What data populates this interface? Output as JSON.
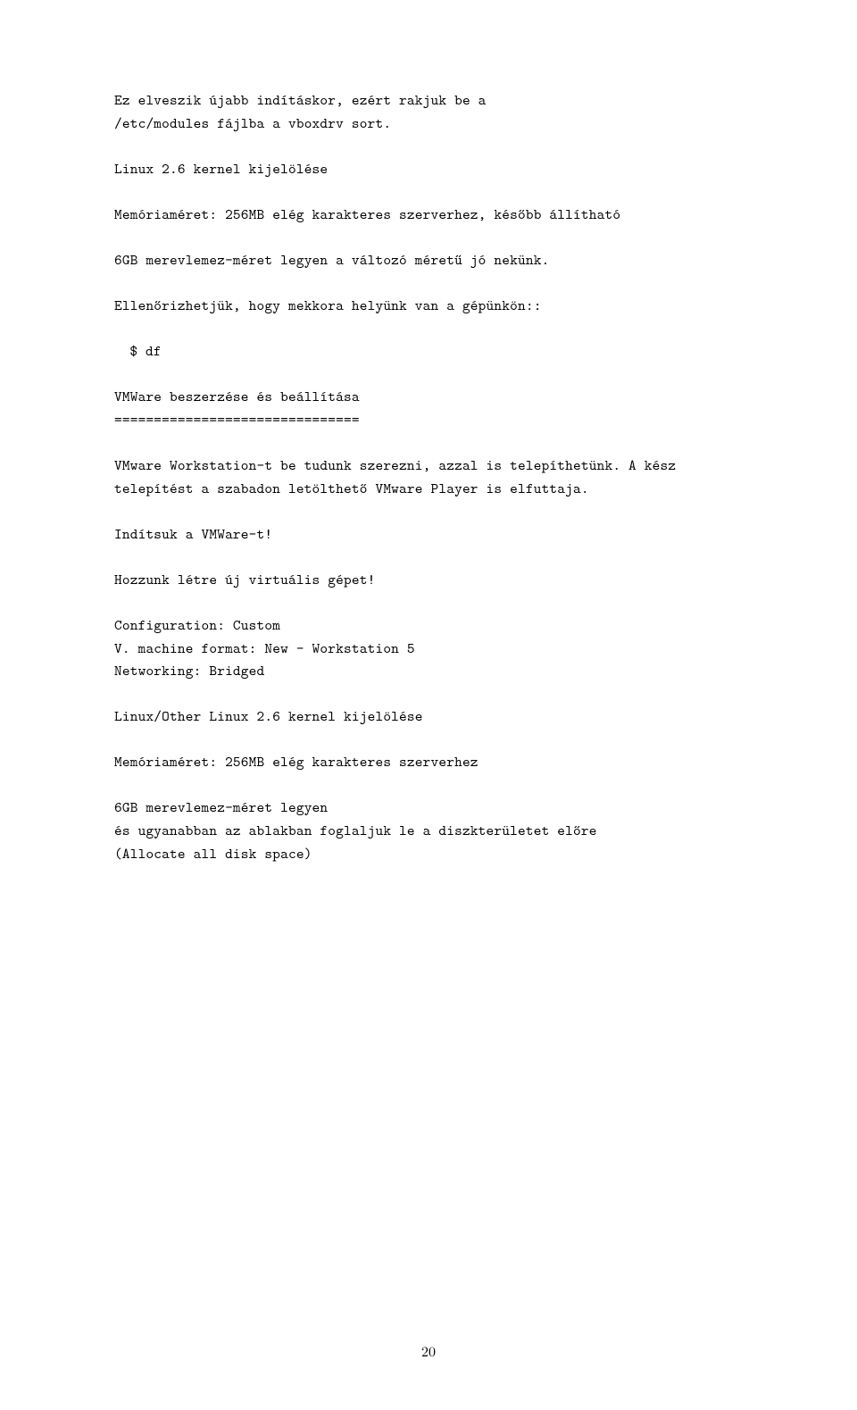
{
  "p1": "Ez elveszik újabb indításkor, ezért rakjuk be a",
  "p2": "/etc/modules fájlba a vboxdrv sort.",
  "p3": "Linux 2.6 kernel kijelölése",
  "p4": "Memóriaméret: 256MB elég karakteres szerverhez, később állítható",
  "p5": "6GB merevlemez-méret legyen a változó méretű jó nekünk.",
  "p6": "Ellenőrizhetjük, hogy mekkora helyünk van a gépünkön::",
  "p7": "$ df",
  "p8": "VMWare beszerzése és beállítása",
  "p9": "===============================",
  "p10": "VMware Workstation-t be tudunk szerezni, azzal is telepíthetünk. A kész telepítést a szabadon letölthető VMware Player is elfuttaja.",
  "p11": "Indítsuk a VMWare-t!",
  "p12": "Hozzunk létre új virtuális gépet!",
  "p13": "Configuration: Custom",
  "p14": "V. machine format: New - Workstation 5",
  "p15": "Networking: Bridged",
  "p16": "Linux/Other Linux 2.6 kernel kijelölése",
  "p17": "Memóriaméret: 256MB elég karakteres szerverhez",
  "p18": "6GB merevlemez-méret legyen",
  "p19": "és ugyanabban az ablakban foglaljuk le a diszkterületet előre",
  "p20": "(Allocate all disk space)",
  "pageNumber": "20"
}
